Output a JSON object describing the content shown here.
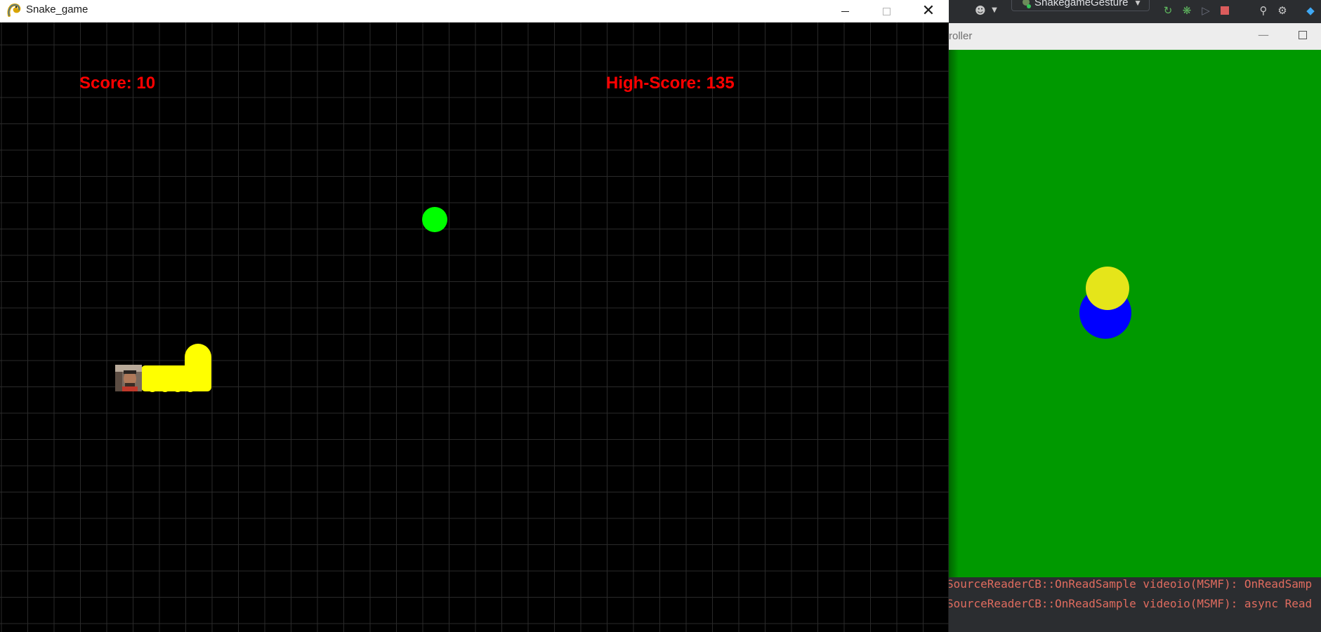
{
  "snake_window": {
    "title": "Snake_game",
    "app_icon": "pygame-snake-icon",
    "buttons": {
      "minimize": "minimize-icon",
      "maximize": "maximize-icon",
      "close": "close-icon"
    },
    "score_label": "Score: 10",
    "highscore_label": "High-Score: 135",
    "colors": {
      "background": "#000000",
      "grid": "#2a2a2a",
      "hud_text": "#ff0000",
      "food": "#00ff00",
      "snake": "#ffff00"
    }
  },
  "ide": {
    "run_config_label": "SnakegameGesture",
    "toolbar_icons": [
      "user-icon",
      "rerun-icon",
      "debug-icon",
      "coverage-icon",
      "stop-icon",
      "search-icon",
      "settings-icon",
      "plugin-icon"
    ]
  },
  "controller_window": {
    "title": "roller",
    "colors": {
      "background": "#009900",
      "indicator_yellow": "#e5e51a",
      "indicator_blue": "#0000ff"
    }
  },
  "console": {
    "lines": [
      "SourceReaderCB::OnReadSample videoio(MSMF): OnReadSamp",
      "SourceReaderCB::OnReadSample videoio(MSMF): async Read"
    ]
  }
}
